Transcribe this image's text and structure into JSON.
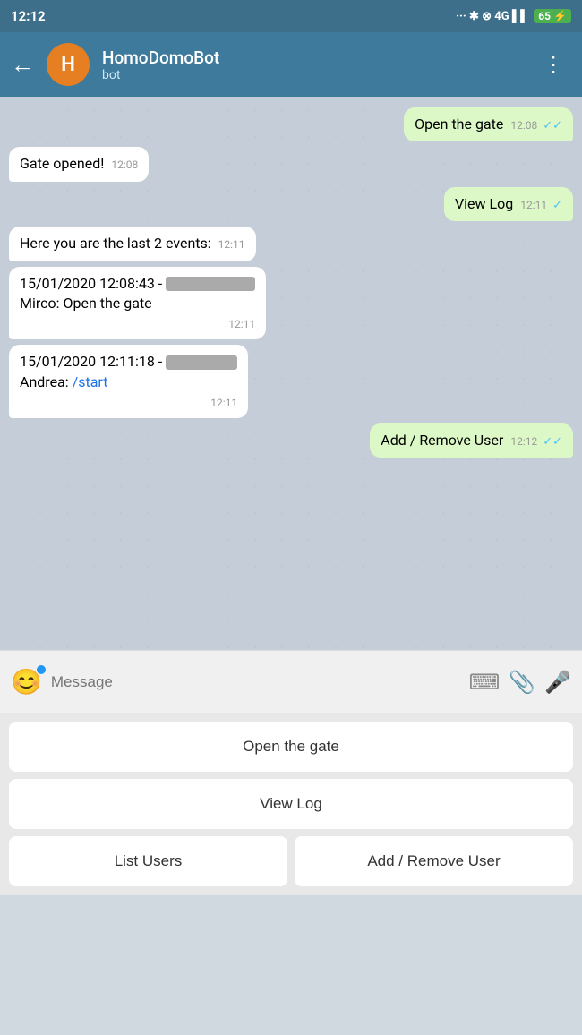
{
  "statusBar": {
    "time": "12:12",
    "rightIcons": "··· ✱ ⊗ 4G",
    "battery": "65"
  },
  "header": {
    "backLabel": "←",
    "avatarInitial": "H",
    "botName": "HomoDomoBot",
    "botSub": "bot",
    "menuIcon": "⋮"
  },
  "messages": [
    {
      "id": "msg1",
      "type": "sent",
      "text": "Open the gate",
      "time": "12:08",
      "checks": "✓✓",
      "checkColor": "blue"
    },
    {
      "id": "msg2",
      "type": "received",
      "text": "Gate opened!",
      "time": "12:08"
    },
    {
      "id": "msg3",
      "type": "sent",
      "text": "View Log",
      "time": "12:11",
      "checks": "✓",
      "checkColor": "blue"
    },
    {
      "id": "msg4",
      "type": "received",
      "text": "Here you are the last 2 events:",
      "time": "12:11"
    },
    {
      "id": "msg5",
      "type": "received",
      "line1": "15/01/2020 12:08:43 -",
      "line2": "Mirco: Open the gate",
      "time": "12:11",
      "hasBlur": true
    },
    {
      "id": "msg6",
      "type": "received",
      "line1": "15/01/2020 12:11:18 -",
      "line2": "Andrea: ",
      "link": "/start",
      "time": "12:11",
      "hasBlur": true
    },
    {
      "id": "msg7",
      "type": "sent",
      "text": "Add / Remove User",
      "time": "12:12",
      "checks": "✓✓",
      "checkColor": "blue"
    }
  ],
  "inputBar": {
    "placeholder": "Message",
    "emojiIcon": "😊",
    "keyboardIcon": "⌨",
    "attachIcon": "📎",
    "micIcon": "🎤"
  },
  "quickButtons": [
    {
      "id": "btn-open-gate",
      "label": "Open the gate",
      "fullWidth": true
    },
    {
      "id": "btn-view-log",
      "label": "View Log",
      "fullWidth": true
    },
    {
      "id": "btn-list-users",
      "label": "List Users",
      "fullWidth": false
    },
    {
      "id": "btn-add-remove",
      "label": "Add / Remove User",
      "fullWidth": false
    }
  ]
}
